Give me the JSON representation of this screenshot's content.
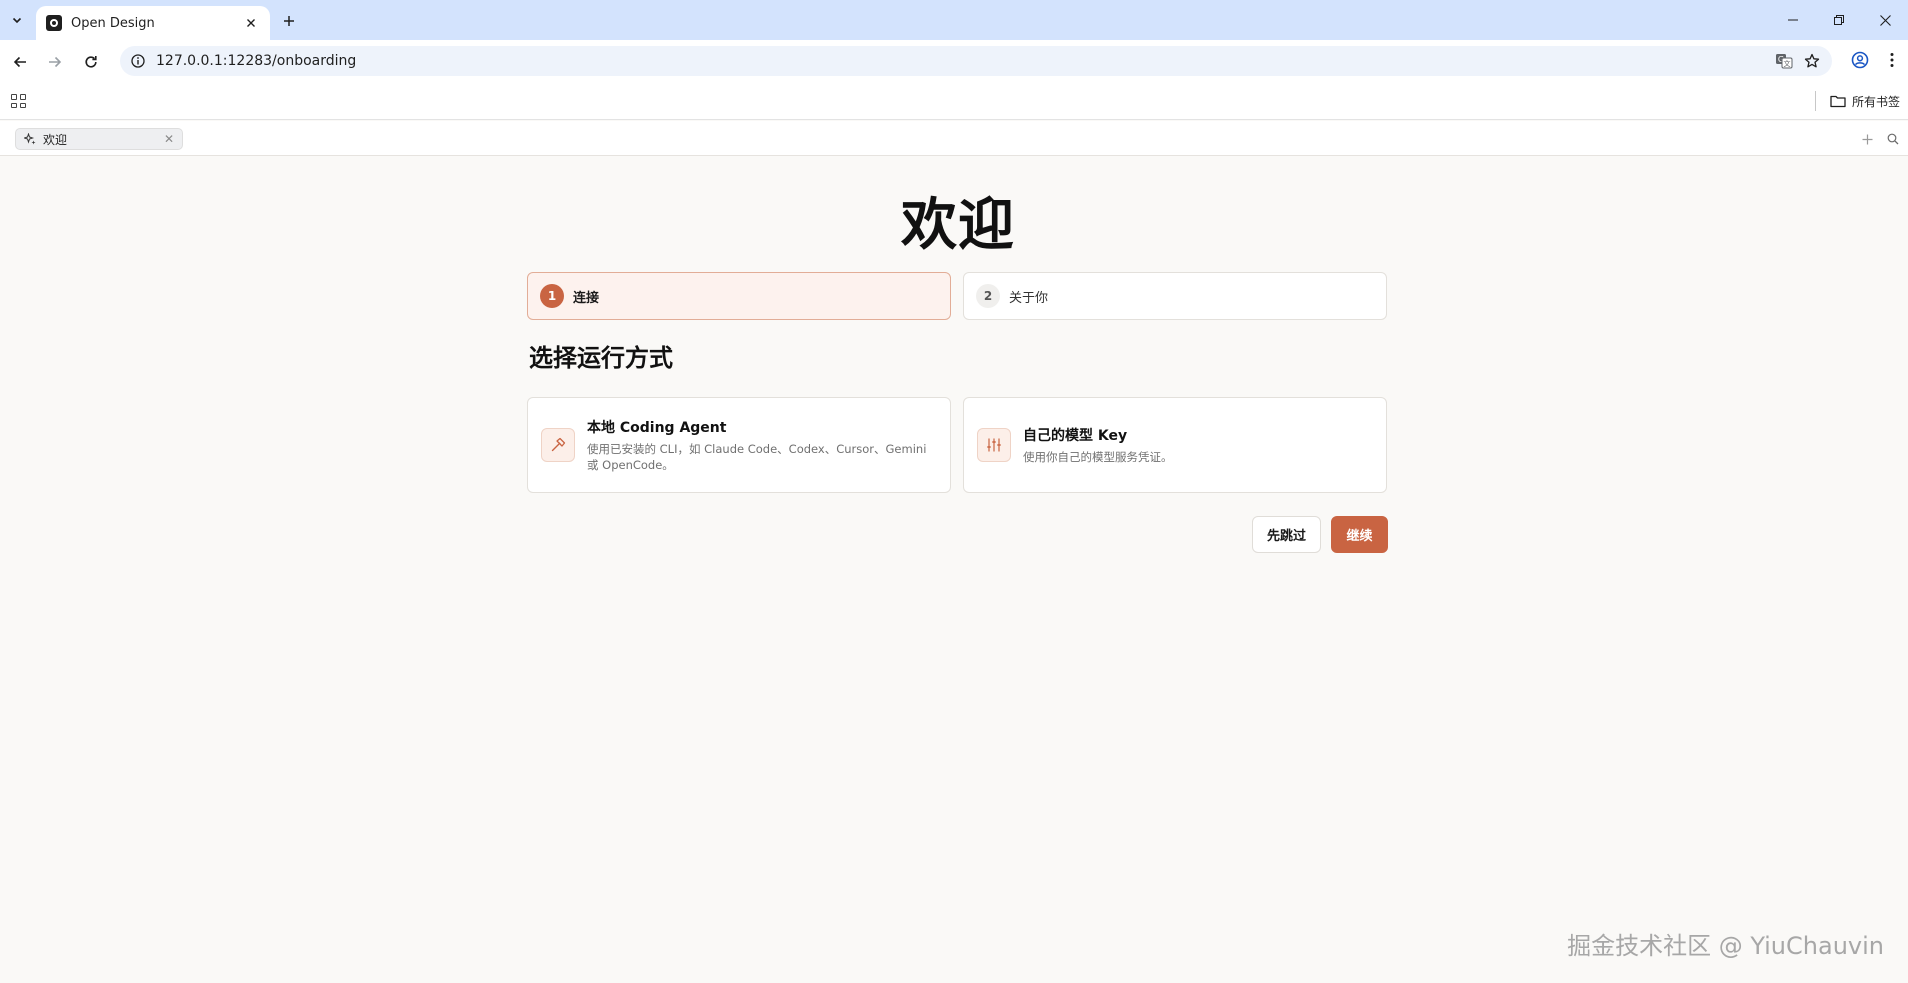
{
  "browser": {
    "tab_title": "Open Design",
    "url": "127.0.0.1:12283/onboarding",
    "bookmarks_all_label": "所有书签"
  },
  "app_tabs": [
    {
      "label": "欢迎"
    }
  ],
  "page": {
    "title": "欢迎",
    "steps": [
      {
        "number": "1",
        "label": "连接",
        "state": "active"
      },
      {
        "number": "2",
        "label": "关于你",
        "state": "inactive"
      }
    ],
    "section_title": "选择运行方式",
    "options": [
      {
        "title": "本地 Coding Agent",
        "description": "使用已安装的 CLI，如 Claude Code、Codex、Cursor、Gemini 或 OpenCode。",
        "icon": "hammer-icon"
      },
      {
        "title": "自己的模型 Key",
        "description": "使用你自己的模型服务凭证。",
        "icon": "sliders-icon"
      }
    ],
    "skip_label": "先跳过",
    "continue_label": "继续"
  },
  "watermark": "掘金技术社区 @ YiuChauvin",
  "colors": {
    "accent": "#c96442",
    "accent_soft_bg": "#fdf2ee",
    "page_bg": "#faf9f7",
    "chrome_tabstrip": "#d3e3fd"
  }
}
